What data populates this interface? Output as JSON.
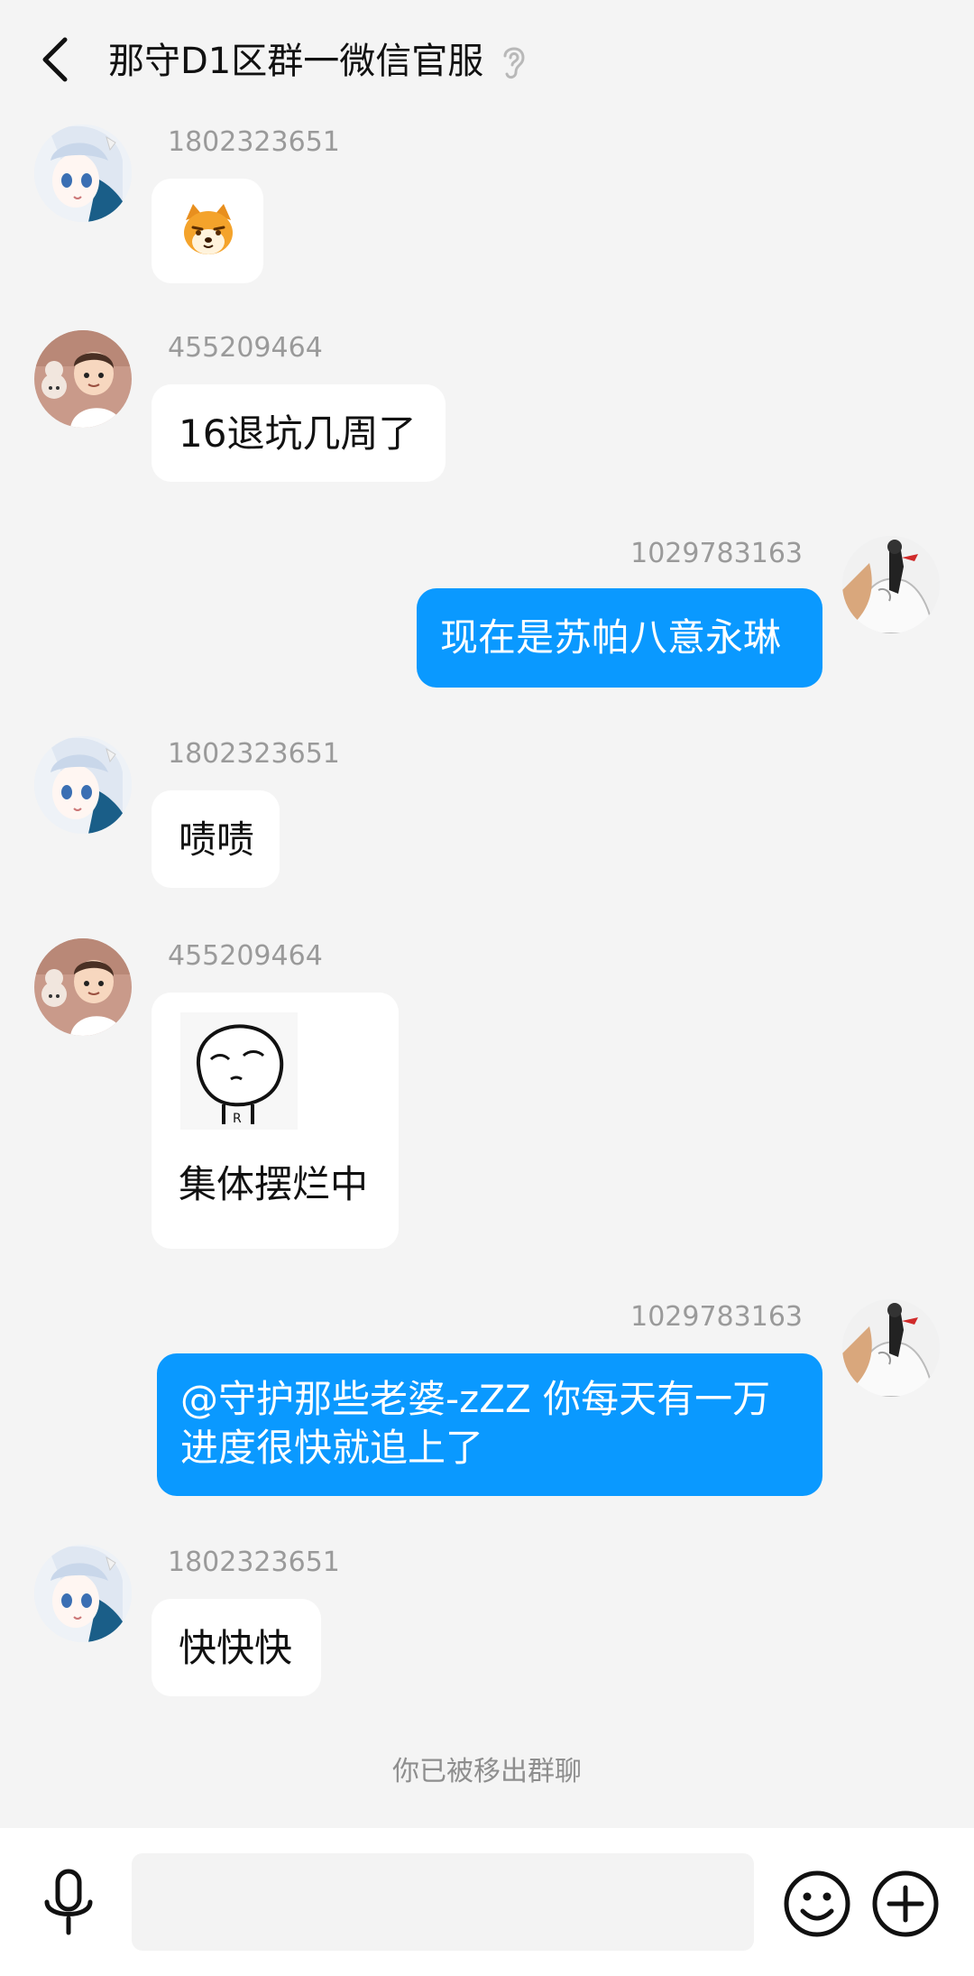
{
  "header": {
    "title": "那守D1区群一微信官服",
    "back_icon": "chevron-left-icon",
    "ear_icon": "ear-icon"
  },
  "messages": [
    {
      "sender": "1802323651",
      "side": "left",
      "kind": "sticker",
      "sticker": "shiba-dog-sticker"
    },
    {
      "sender": "455209464",
      "side": "left",
      "kind": "text",
      "text": "16退坑几周了"
    },
    {
      "sender": "1029783163",
      "side": "right",
      "kind": "text",
      "text": "现在是苏帕八意永琳"
    },
    {
      "sender": "1802323651",
      "side": "left",
      "kind": "text",
      "text": "啧啧"
    },
    {
      "sender": "455209464",
      "side": "left",
      "kind": "image-text",
      "sticker": "doodle-face-sticker",
      "text": "集体摆烂中"
    },
    {
      "sender": "1029783163",
      "side": "right",
      "kind": "text",
      "text_lines": [
        "@守护那些老婆-zZZ 你每天有一万",
        "进度很快就追上了"
      ]
    },
    {
      "sender": "1802323651",
      "side": "left",
      "kind": "text",
      "text": "快快快"
    }
  ],
  "system_note": "你已被移出群聊",
  "footer": {
    "mic_icon": "microphone-icon",
    "input_placeholder": "",
    "emoji_icon": "emoji-icon",
    "plus_icon": "plus-icon"
  },
  "colors": {
    "background": "#f4f4f4",
    "outgoing_bubble": "#0a99ff",
    "incoming_bubble": "#ffffff",
    "meta_text": "#9a9a9a"
  }
}
